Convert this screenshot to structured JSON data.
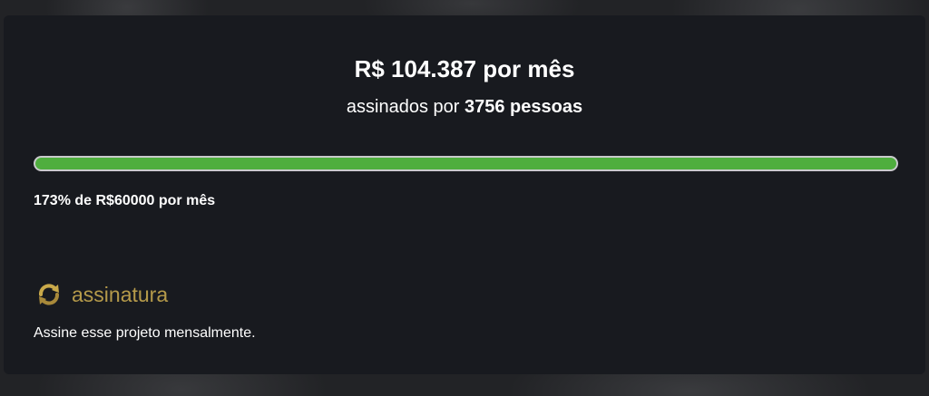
{
  "pledge": {
    "amount_text": "R$ 104.387 por mês",
    "subscribers_prefix": "assinados por",
    "subscribers_count": "3756 pessoas"
  },
  "progress": {
    "percent_funded": 173,
    "display_fill_fraction": 1.0,
    "goal_text": "173% de R$60000 por mês"
  },
  "brand": {
    "name": "assinatura",
    "icon": "subscription-refresh-icon",
    "description": "Assine esse projeto mensalmente."
  },
  "colors": {
    "card_background": "#181a1f",
    "progress_fill": "#4fae3e",
    "progress_track": "#c9cacc",
    "brand_gold": "#b59a4a",
    "text": "#ffffff"
  }
}
